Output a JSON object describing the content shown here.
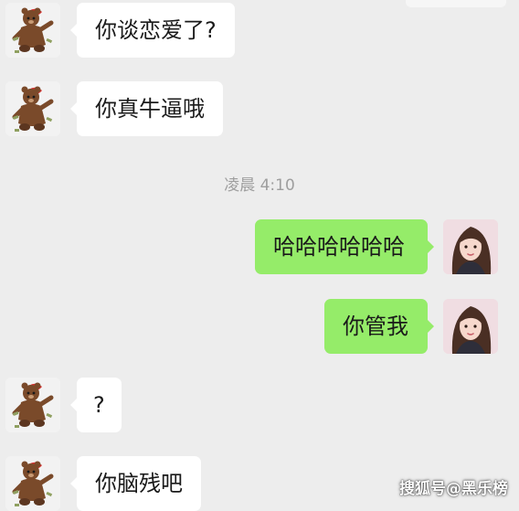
{
  "chat": {
    "messages": [
      {
        "side": "left",
        "text": "你谈恋爱了?"
      },
      {
        "side": "left",
        "text": "你真牛逼哦"
      },
      {
        "side": "right",
        "text": "哈哈哈哈哈哈"
      },
      {
        "side": "right",
        "text": "你管我"
      },
      {
        "side": "left",
        "text": "?"
      },
      {
        "side": "left",
        "text": "你脑残吧"
      }
    ],
    "timestamp": "凌晨 4:10"
  },
  "avatars": {
    "left": "bear-avatar",
    "right": "girl-avatar"
  },
  "watermark": "搜狐号@黑乐榜",
  "colors": {
    "background": "#ededed",
    "left_bubble": "#ffffff",
    "right_bubble": "#95ec69",
    "timestamp": "#9e9e9e"
  }
}
